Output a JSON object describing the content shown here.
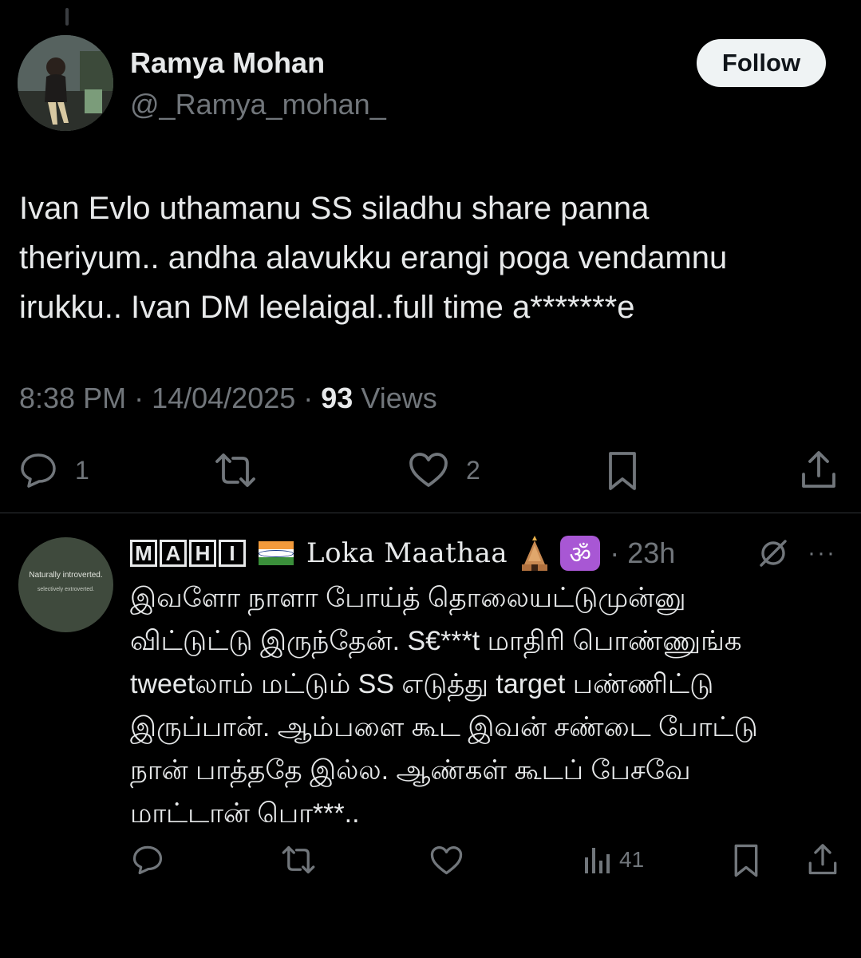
{
  "tweet": {
    "author_name": "Ramya Mohan",
    "author_handle": "@_Ramya_mohan_",
    "follow_label": "Follow",
    "text_lines": [
      "Ivan Evlo uthamanu SS siladhu share panna",
      "theriyum.. andha alavukku erangi poga vendamnu",
      "irukku.. Ivan DM leelaigal..full time a*******e"
    ],
    "time": "8:38 PM",
    "date": "14/04/2025",
    "separator": " · ",
    "views_count": "93",
    "views_label": "Views",
    "actions": {
      "reply_count": "1",
      "like_count": "2"
    }
  },
  "reply": {
    "name_boxed": [
      "M",
      "A",
      "H",
      "I"
    ],
    "name_suffix": "Loka Maathaa",
    "om_symbol": "ॐ",
    "time": "23h",
    "more": "···",
    "avatar_text": [
      "Naturally introverted.",
      "selectively extroverted."
    ],
    "text_lines": [
      "இவளோ நாளா போய்த் தொலையட்டுமுன்னு",
      "விட்டுட்டு இருந்தேன். S€***t மாதிரி பொண்ணுங்க",
      "tweetலாம் மட்டும் SS எடுத்து target பண்ணிட்டு",
      "இருப்பான். ஆம்பளை கூட இவன் சண்டை போட்டு",
      "நான் பாத்ததே இல்ல. ஆண்கள் கூடப் பேசவே",
      "மாட்டான் பொ***.."
    ],
    "views_count": "41"
  },
  "colors": {
    "background": "#000000",
    "text": "#e7e9ea",
    "muted": "#71767b",
    "divider": "#2f3336",
    "om_badge": "#a857d4"
  },
  "icons": [
    "reply-icon",
    "retweet-icon",
    "like-icon",
    "bookmark-icon",
    "share-icon",
    "views-icon",
    "grok-icon",
    "more-icon"
  ]
}
